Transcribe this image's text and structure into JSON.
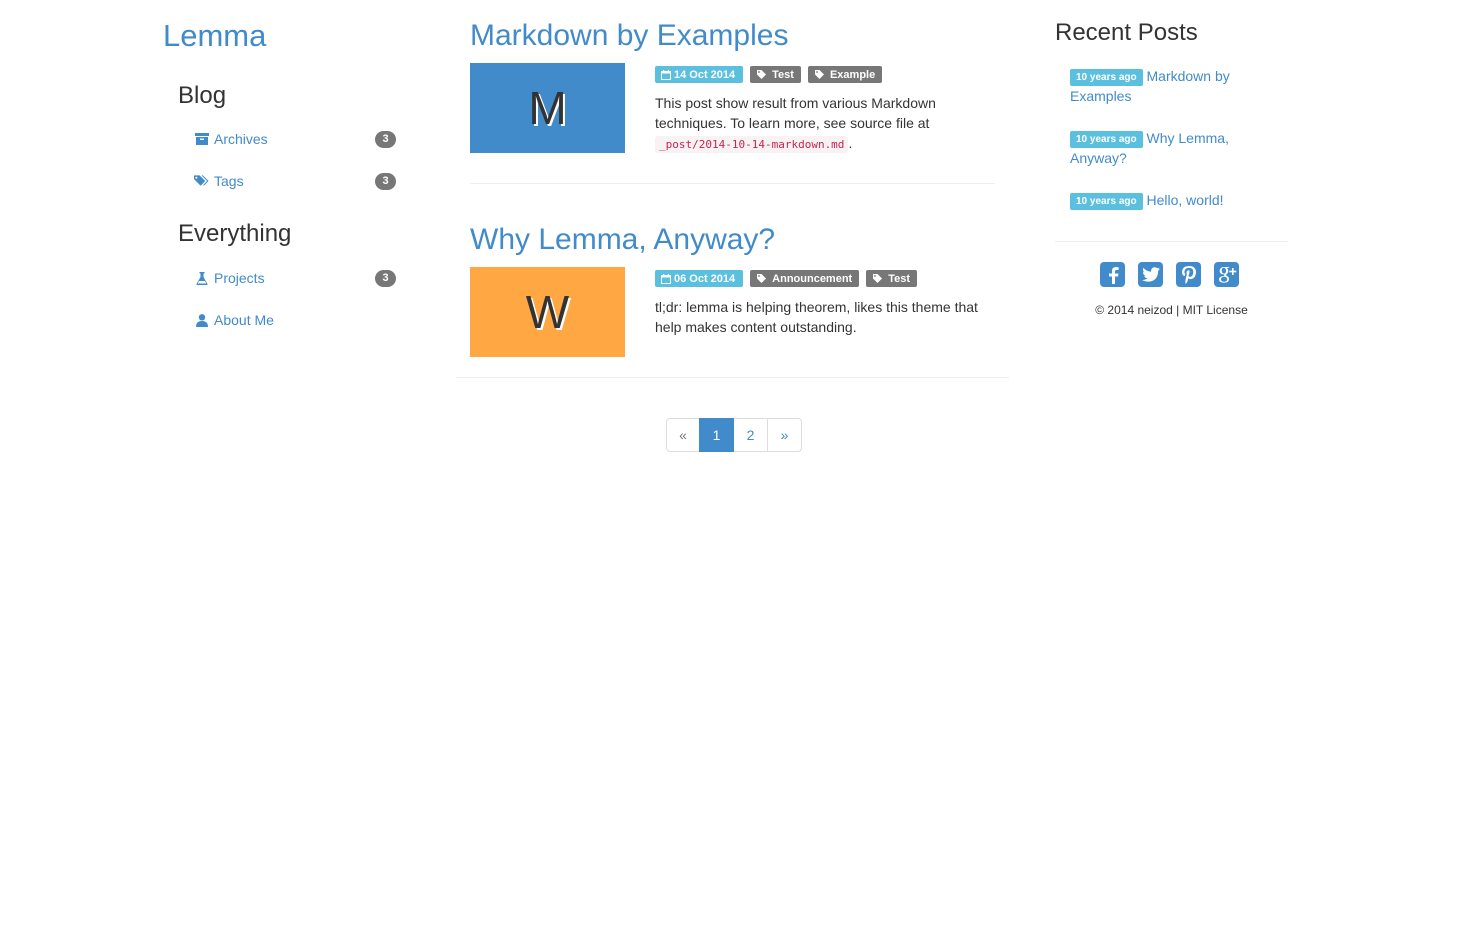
{
  "site": {
    "title": "Lemma"
  },
  "sidebar": {
    "blog_heading": "Blog",
    "blog_items": [
      {
        "label": "Archives",
        "count": "3",
        "icon": "archive-icon"
      },
      {
        "label": "Tags",
        "count": "3",
        "icon": "tags-icon"
      }
    ],
    "everything_heading": "Everything",
    "everything_items": [
      {
        "label": "Projects",
        "count": "3",
        "icon": "flask-icon"
      },
      {
        "label": "About Me",
        "icon": "user-icon"
      }
    ]
  },
  "posts": [
    {
      "title": "Markdown by Examples",
      "thumb_letter": "M",
      "thumb_color": "#428bca",
      "date": "14 Oct 2014",
      "tags": [
        "Test",
        "Example"
      ],
      "excerpt_text": "This post show result from various Markdown techniques. To learn more, see source file at",
      "excerpt_code": "_post/2014-10-14-markdown.md",
      "excerpt_end": "."
    },
    {
      "title": "Why Lemma, Anyway?",
      "thumb_letter": "W",
      "thumb_color": "#ffa843",
      "date": "06 Oct 2014",
      "tags": [
        "Announcement",
        "Test"
      ],
      "excerpt_text": "tl;dr: lemma is helping theorem, likes this theme that help makes content outstanding."
    }
  ],
  "pagination": {
    "prev": "«",
    "pages": [
      "1",
      "2"
    ],
    "active": "1",
    "next": "»"
  },
  "recent": {
    "heading": "Recent Posts",
    "items": [
      {
        "ago": "10 years ago",
        "title": "Markdown by Examples"
      },
      {
        "ago": "10 years ago",
        "title": "Why Lemma, Anyway?"
      },
      {
        "ago": "10 years ago",
        "title": "Hello, world!"
      }
    ]
  },
  "social": [
    "facebook-icon",
    "twitter-icon",
    "pinterest-icon",
    "google-plus-icon"
  ],
  "footer": {
    "text": "© 2014 neizod | MIT License"
  },
  "colors": {
    "accent": "#428bca",
    "info": "#5bc0de",
    "muted": "#777777"
  }
}
